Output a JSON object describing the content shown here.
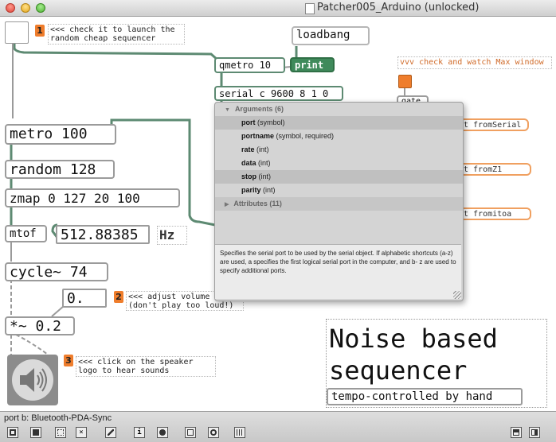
{
  "window": {
    "title": "Patcher005_Arduino (unlocked)"
  },
  "canvas": {
    "objects": {
      "loadbang": "loadbang",
      "qmetro": "qmetro 10",
      "print": "print",
      "serial": "serial c 9600 8 1 0",
      "metro": "metro 100",
      "random": "random 128",
      "zmap": "zmap 0 127 20 100",
      "mtof": "mtof",
      "number": "512.88385",
      "hz": "Hz",
      "cycle": "cycle~ 74",
      "volume": "0.",
      "mult": "*~ 0.2"
    },
    "comments": {
      "c1": "<<< check it to launch the\nrandom cheap sequencer",
      "c2": "<<< adjust volume\n(don't play too loud!)",
      "c3": "<<< click on the speaker\nlogo to hear sounds",
      "max_window": "vvv check and watch Max window"
    },
    "badges": {
      "b1": "1",
      "b2": "2",
      "b3": "3"
    },
    "partial_objects": {
      "p1": "t fromSerial",
      "p2": "t fromZ1",
      "p3": "t fromitoa",
      "p4": "gate"
    },
    "title_card": {
      "title": "Noise based\nsequencer",
      "subtitle": "tempo-controlled by hand"
    }
  },
  "autocomplete": {
    "arguments_header": "Arguments (6)",
    "arguments": [
      {
        "name": "port",
        "desc": "(symbol)"
      },
      {
        "name": "portname",
        "desc": "(symbol, required)"
      },
      {
        "name": "rate",
        "desc": "(int)"
      },
      {
        "name": "data",
        "desc": "(int)"
      },
      {
        "name": "stop",
        "desc": "(int)"
      },
      {
        "name": "parity",
        "desc": "(int)"
      }
    ],
    "attributes_header": "Attributes (11)",
    "description": "Specifies the serial port to be used by the serial object. If alphabetic shortcuts (a-z) are used, a specifies the first logical serial port in the computer, and b- z are used to specify additional ports."
  },
  "status": {
    "text": "port b: Bluetooth-PDA-Sync"
  },
  "colors": {
    "badge": "#ef7d2c",
    "cord_green": "#5d8a72",
    "cord_gray": "#9a9a9a",
    "print_green": "#3f8a5b"
  }
}
